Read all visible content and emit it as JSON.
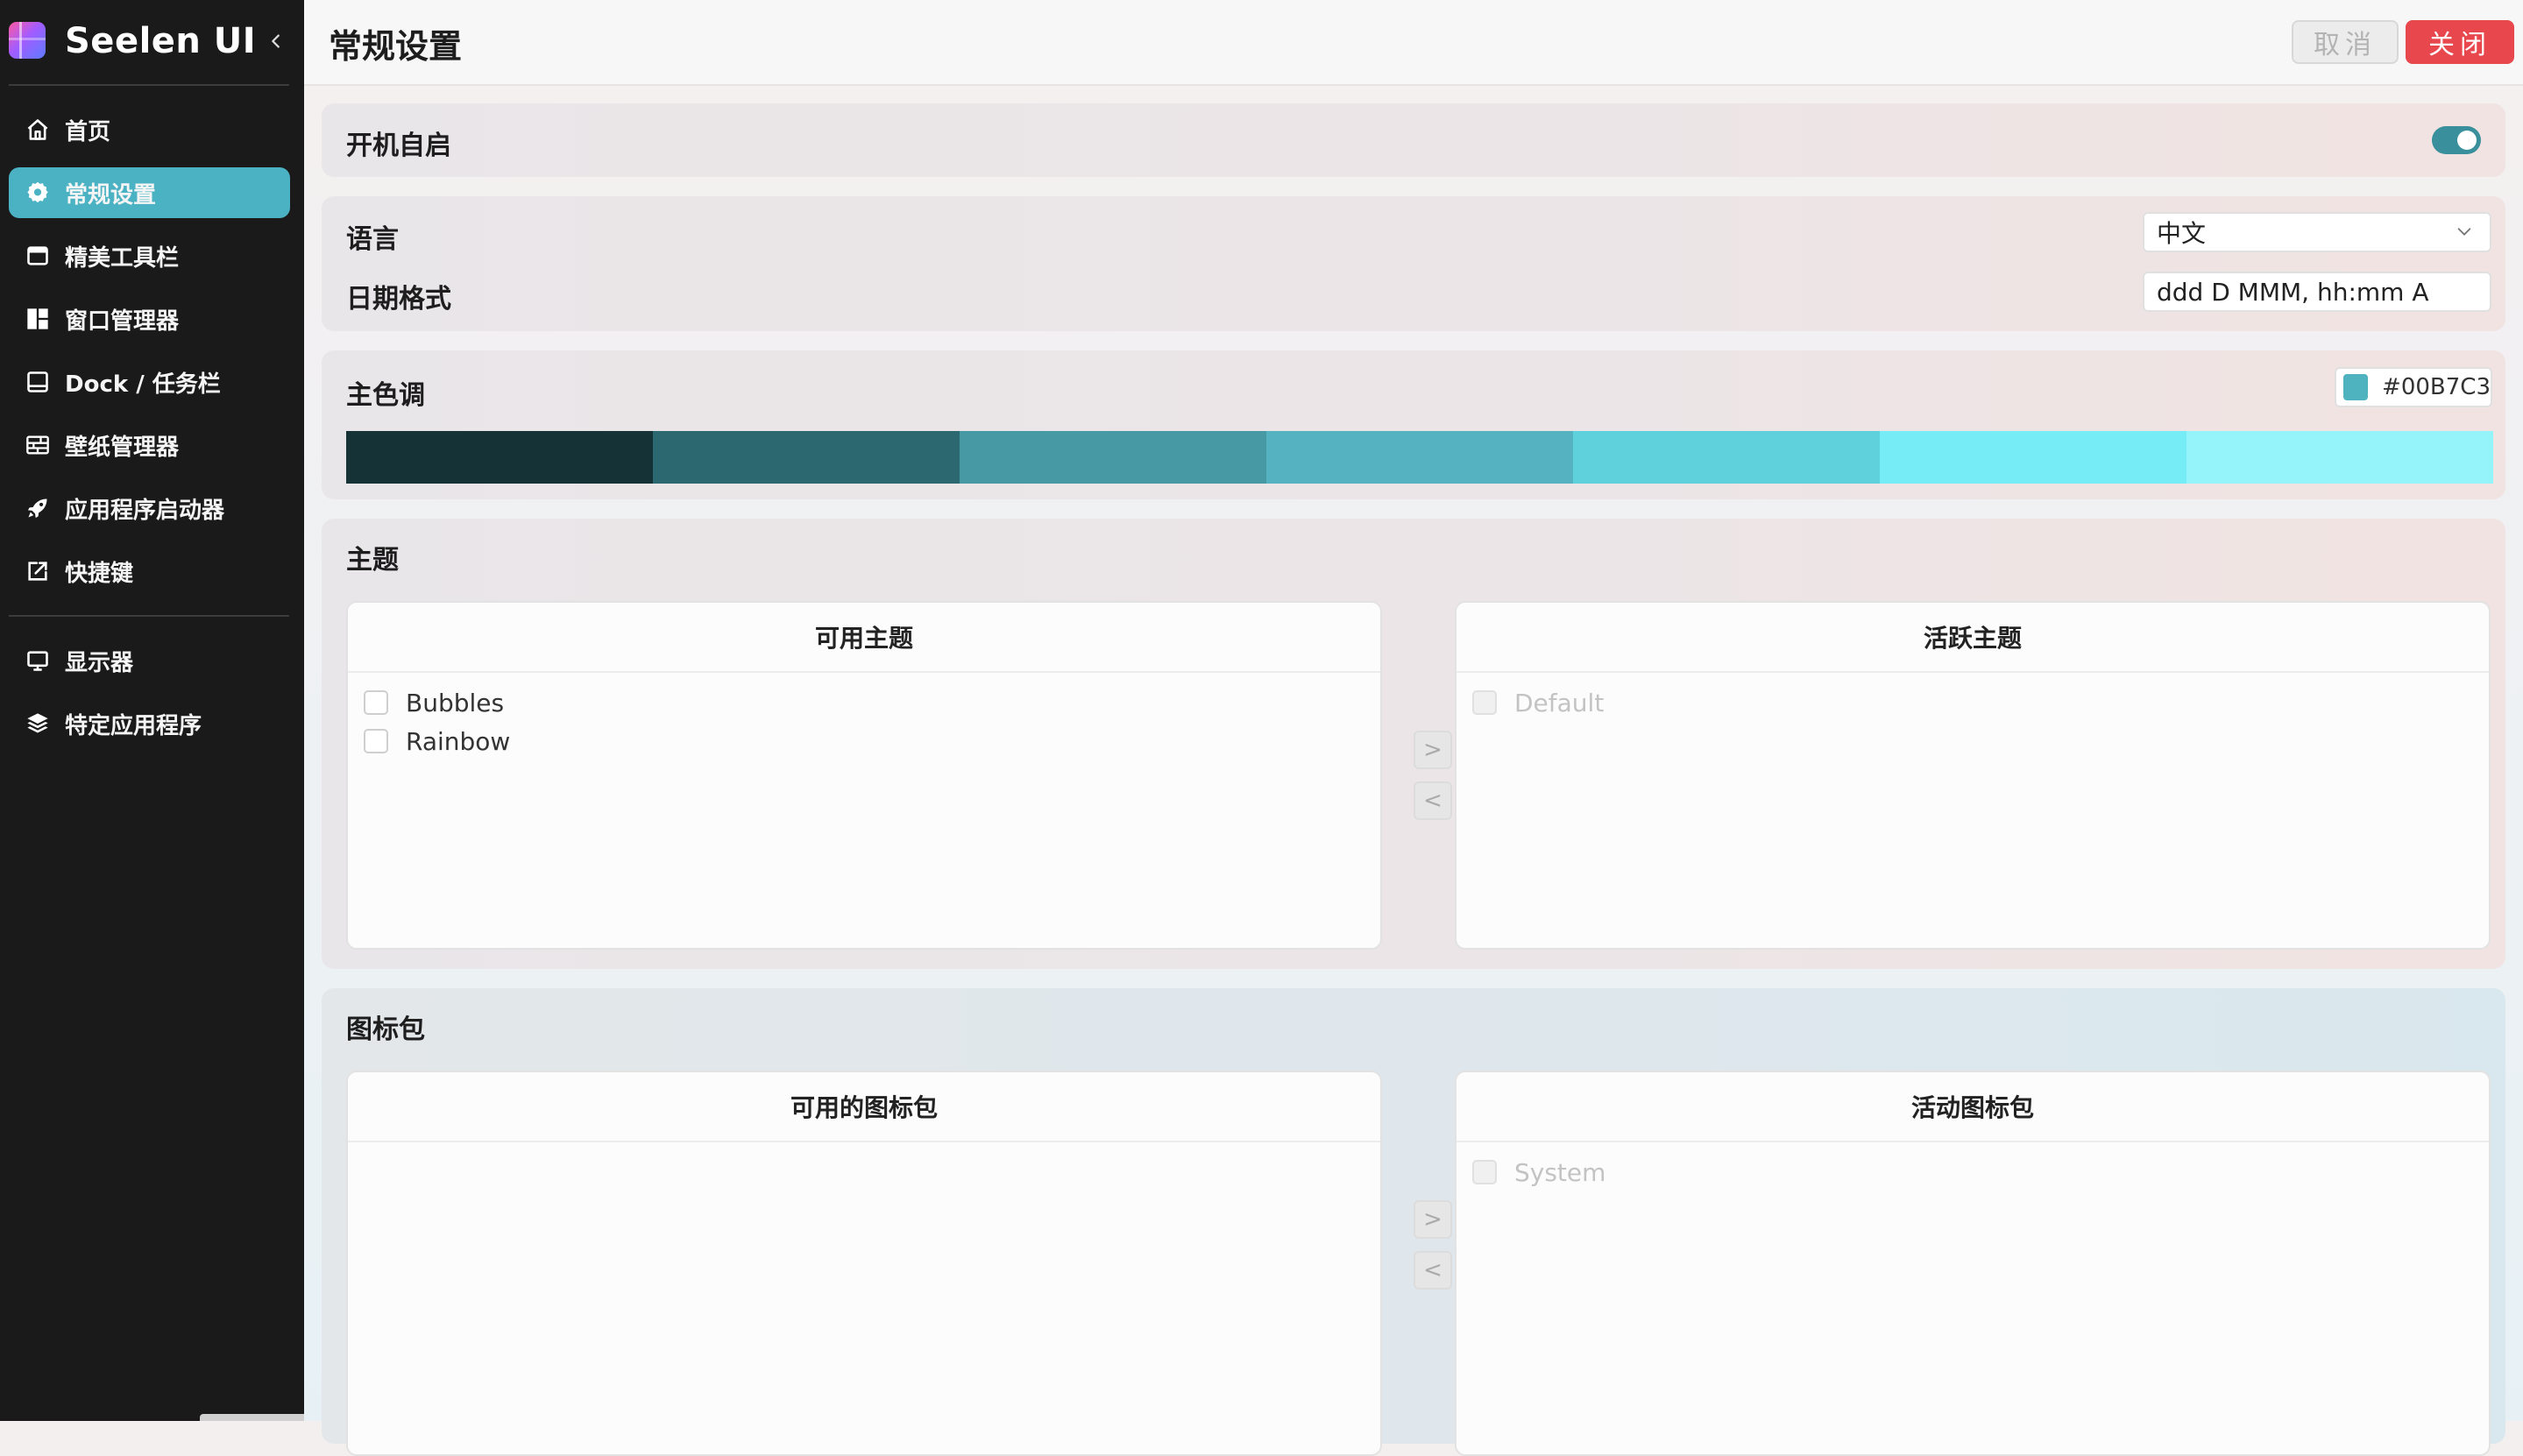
{
  "sidebar": {
    "brand": "Seelen UI",
    "items": [
      {
        "label": "首页",
        "icon": "home-icon"
      },
      {
        "label": "常规设置",
        "icon": "gear-icon",
        "active": true
      },
      {
        "label": "精美工具栏",
        "icon": "toolbar-icon"
      },
      {
        "label": "窗口管理器",
        "icon": "window-manager-icon"
      },
      {
        "label": "Dock / 任务栏",
        "icon": "dock-icon"
      },
      {
        "label": "壁纸管理器",
        "icon": "wallpaper-icon"
      },
      {
        "label": "应用程序启动器",
        "icon": "rocket-icon"
      },
      {
        "label": "快捷键",
        "icon": "shortcut-icon"
      }
    ],
    "items2": [
      {
        "label": "显示器",
        "icon": "monitor-icon"
      },
      {
        "label": "特定应用程序",
        "icon": "layers-icon"
      }
    ]
  },
  "header": {
    "title": "常规设置",
    "cancel_label": "取消",
    "close_label": "关闭"
  },
  "settings": {
    "autostart": {
      "label": "开机自启",
      "enabled": true
    },
    "language": {
      "label": "语言",
      "value": "中文"
    },
    "date_format": {
      "label": "日期格式",
      "value": "ddd D MMM, hh:mm A"
    },
    "accent": {
      "label": "主色调",
      "value": "#00B7C3",
      "palette": [
        "#153237",
        "#2b6870",
        "#4799a4",
        "#54b2c1",
        "#5fd1dd",
        "#76ecf7",
        "#95f4fa"
      ]
    },
    "themes": {
      "label": "主题",
      "available_title": "可用主题",
      "active_title": "活跃主题",
      "available": [
        "Bubbles",
        "Rainbow"
      ],
      "active": [
        "Default"
      ],
      "move_right": ">",
      "move_left": "<"
    },
    "icon_packs": {
      "label": "图标包",
      "available_title": "可用的图标包",
      "active_title": "活动图标包",
      "available": [],
      "active": [
        "System"
      ],
      "move_right": ">",
      "move_left": "<"
    }
  },
  "colors": {
    "sidebar_bg": "#1b1a1a",
    "active_item": "#4ab2c2",
    "close_button": "#e8474d",
    "toggle_on": "#3a8f9c",
    "accent_swatch": "#4fb3bf"
  }
}
